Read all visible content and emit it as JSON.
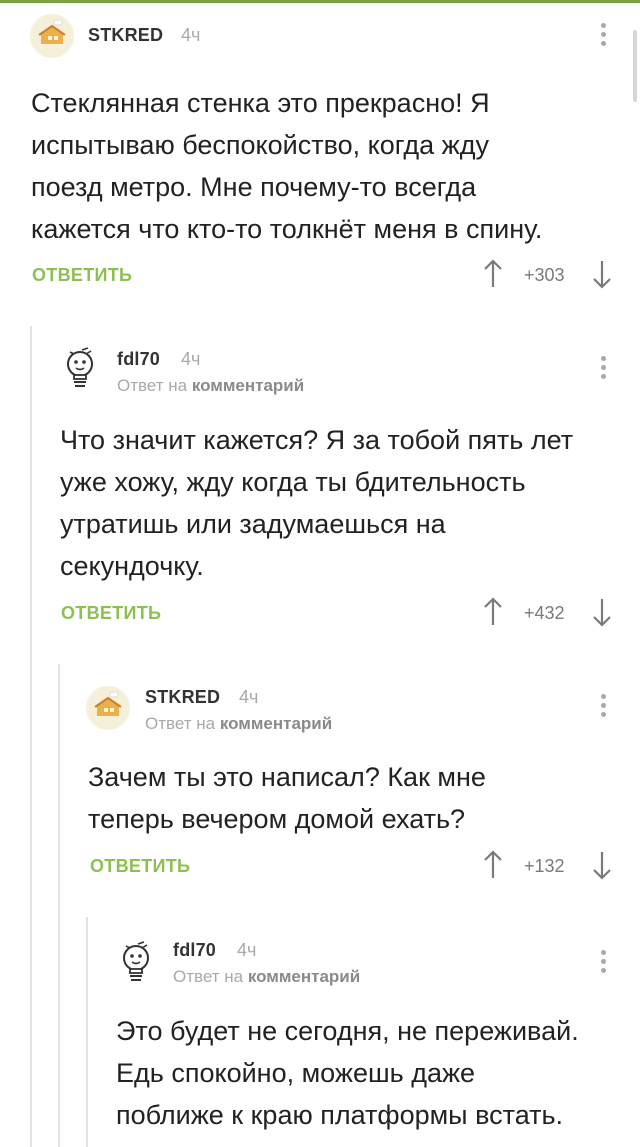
{
  "comments": [
    {
      "user": "STKRED",
      "time": "4ч",
      "reply_prefix": "",
      "reply_target": "",
      "text_lines": [
        "Стеклянная стенка это прекрасно! Я",
        "испытываю беспокойство, когда жду",
        "поезд метро. Мне почему-то всегда",
        "кажется что кто-то толкнёт меня в спину."
      ],
      "reply_label": "ОТВЕТИТЬ",
      "score": "+303",
      "avatar_icon": "house-avatar-icon"
    },
    {
      "user": "fdl70",
      "time": "4ч",
      "reply_prefix": "Ответ на",
      "reply_target": "комментарий",
      "text_lines": [
        "Что значит кажется? Я за тобой пять лет",
        "уже хожу, жду когда ты бдительность",
        "утратишь или задумаешься на",
        "секундочку."
      ],
      "reply_label": "ОТВЕТИТЬ",
      "score": "+432",
      "avatar_icon": "lightbulb-avatar-icon"
    },
    {
      "user": "STKRED",
      "time": "4ч",
      "reply_prefix": "Ответ на",
      "reply_target": "комментарий",
      "text_lines": [
        "Зачем ты это написал? Как мне",
        "теперь вечером домой ехать?"
      ],
      "reply_label": "ОТВЕТИТЬ",
      "score": "+132",
      "avatar_icon": "house-avatar-icon"
    },
    {
      "user": "fdl70",
      "time": "4ч",
      "reply_prefix": "Ответ на",
      "reply_target": "комментарий",
      "text_lines": [
        "Это будет не сегодня, не переживай.",
        "Едь спокойно, можешь даже",
        "поближе к краю платформы встать."
      ],
      "reply_label": "",
      "score": "",
      "avatar_icon": "lightbulb-avatar-icon"
    }
  ],
  "colors": {
    "accent_green": "#8cc152",
    "top_bar_green": "#7aa33f",
    "meta_gray": "#a9a9a9",
    "text_dark": "#222222"
  }
}
